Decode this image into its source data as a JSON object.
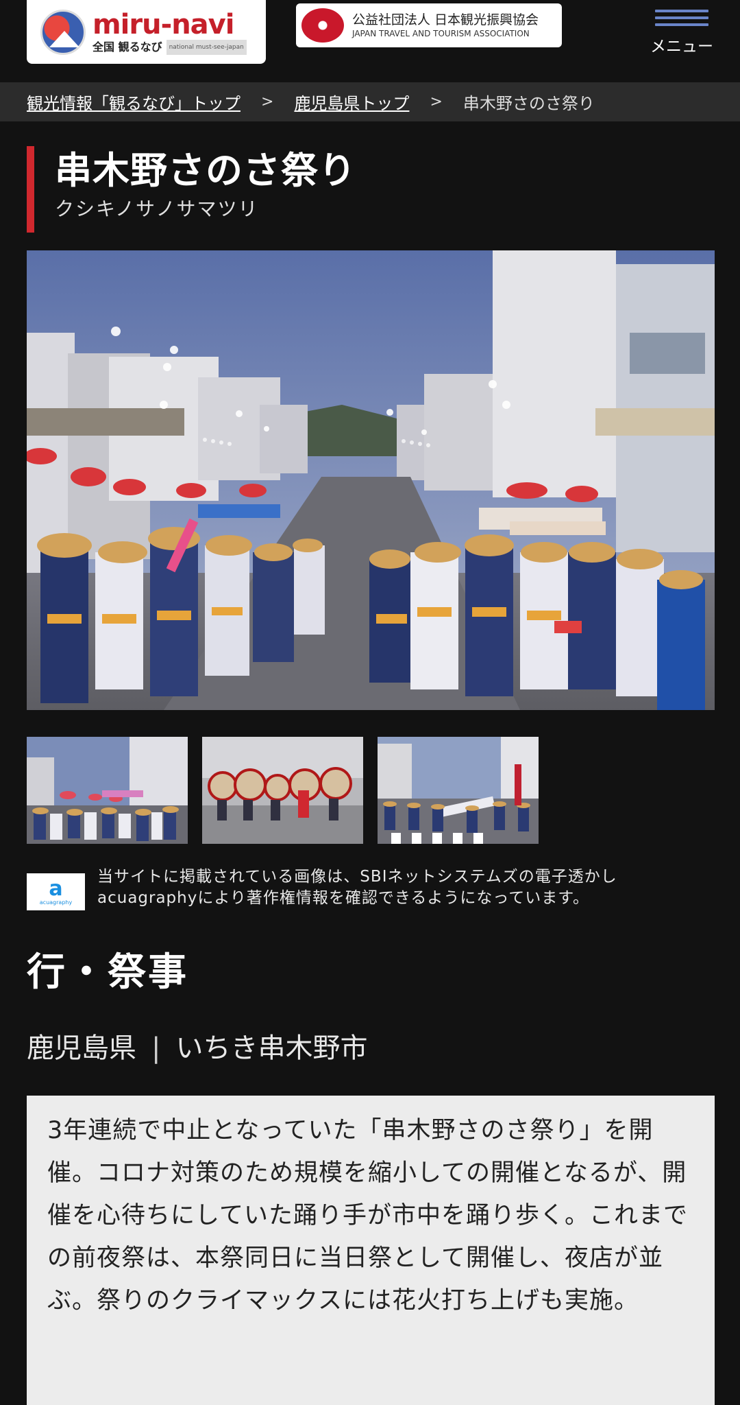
{
  "header": {
    "logo": {
      "main": "miru-navi",
      "sub_jp": "全国 観るなび",
      "sub_en": "national must-see-japan"
    },
    "partner": {
      "name_jp": "公益社団法人 日本観光振興協会",
      "name_en": "JAPAN TRAVEL AND TOURISM ASSOCIATION"
    },
    "menu_label": "メニュー"
  },
  "breadcrumb": {
    "home": "観光情報「観るなび」トップ",
    "sep": ">",
    "prefecture": "鹿児島県トップ",
    "current": "串木野さのさ祭り"
  },
  "event": {
    "title": "串木野さのさ祭り",
    "kana": "クシキノサノサマツリ",
    "category": "行・祭事",
    "prefecture": "鹿児島県",
    "location_sep": "|",
    "city": "いちき串木野市",
    "description": "3年連続で中止となっていた「串木野さのさ祭り」を開催。コロナ対策のため規模を縮小しての開催となるが、開催を心待ちにしていた踊り手が市中を踊り歩く。これまでの前夜祭は、本祭同日に当日祭として開催し、夜店が並ぶ。祭りのクライマックスには花火打ち上げも実施。"
  },
  "notice": {
    "logo_text": "acuagraphy",
    "text_line1": "当サイトに掲載されている画像は、SBIネットシステムズの電子透かし",
    "text_line2": "acuagraphyにより著作権情報を確認できるようになっています。"
  },
  "colors": {
    "background": "#121212",
    "breadcrumb_bg": "#2c2c2c",
    "accent_red": "#d0282e",
    "description_bg": "#ececec"
  }
}
